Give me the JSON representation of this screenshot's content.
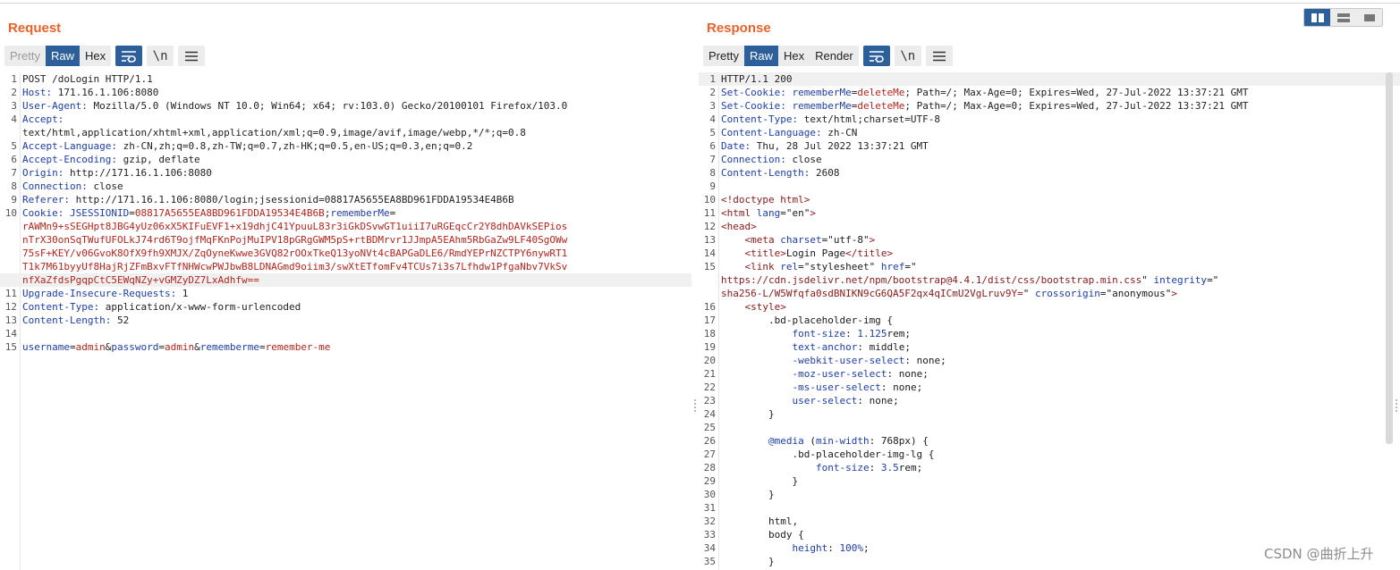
{
  "request": {
    "title": "Request",
    "tabs": [
      "Pretty",
      "Raw",
      "Hex"
    ],
    "active_tab": "Raw",
    "newline_label": "\\n",
    "lines": [
      {
        "n": "1",
        "k": "",
        "v": "POST /doLogin HTTP/1.1"
      },
      {
        "n": "2",
        "k": "Host:",
        "v": " 171.16.1.106:8080"
      },
      {
        "n": "3",
        "k": "User-Agent:",
        "v": " Mozilla/5.0 (Windows NT 10.0; Win64; x64; rv:103.0) Gecko/20100101 Firefox/103.0"
      },
      {
        "n": "4",
        "k": "Accept:",
        "v": ""
      },
      {
        "n": "",
        "k": "",
        "v": "text/html,application/xhtml+xml,application/xml;q=0.9,image/avif,image/webp,*/*;q=0.8"
      },
      {
        "n": "5",
        "k": "Accept-Language:",
        "v": " zh-CN,zh;q=0.8,zh-TW;q=0.7,zh-HK;q=0.5,en-US;q=0.3,en;q=0.2"
      },
      {
        "n": "6",
        "k": "Accept-Encoding:",
        "v": " gzip, deflate"
      },
      {
        "n": "7",
        "k": "Origin:",
        "v": " http://171.16.1.106:8080"
      },
      {
        "n": "8",
        "k": "Connection:",
        "v": " close"
      },
      {
        "n": "9",
        "k": "Referer:",
        "v": " http://171.16.1.106:8080/login;jsessionid=08817A5655EA8BD961FDDA19534E4B6B"
      }
    ],
    "cookie": {
      "n": "10",
      "k": "Cookie:",
      "jsession_key": "JSESSIONID",
      "jsession_val": "08817A5655EA8BD961FDDA19534E4B6B",
      "rm_key": "rememberMe",
      "continuation": [
        "rAWMn9+sSEGHpt8JBG4yUz06xX5KIFuEVF1+x19dhjC41YpuuL83r3iGkDSvwGT1uiiI7uRGEqcCr2Y8dhDAVkSEPios",
        "nTrX30onSqTWufUFOLkJ74rd6T9ojfMqFKnPojMuIPV18pGRgGWM5pS+rtBDMrvr1JJmpA5EAhm5RbGaZw9LF40SgOWw",
        "75sF+KEY/v06GvoK8OfX9fh9XMJX/ZqOyneKwwe3GVQ82rOOxTkeQ13yoNVt4cBAPGaDLE6/RmdYEPrNZCTPY6nywRT1",
        "T1k7M61byyUf8HajRjZFmBxvFTfNHWcwPWJbwB8LDNAGmd9oiim3/swXtETfomFv4TCUs7i3s7Lfhdw1PfgaNbv7VkSv",
        "nfXaZfdsPgqpCtC5EWqNZy+vGMZyDZ7LxAdhfw=="
      ]
    },
    "after_lines": [
      {
        "n": "11",
        "k": "Upgrade-Insecure-Requests:",
        "v": " 1"
      },
      {
        "n": "12",
        "k": "Content-Type:",
        "v": " application/x-www-form-urlencoded"
      },
      {
        "n": "13",
        "k": "Content-Length:",
        "v": " 52"
      },
      {
        "n": "14",
        "k": "",
        "v": ""
      }
    ],
    "body_line": {
      "n": "15",
      "params": [
        {
          "k": "username",
          "v": "admin"
        },
        {
          "k": "password",
          "v": "admin"
        },
        {
          "k": "rememberme",
          "v": "remember-me"
        }
      ]
    }
  },
  "response": {
    "title": "Response",
    "tabs": [
      "Pretty",
      "Raw",
      "Hex",
      "Render"
    ],
    "active_tab": "Raw",
    "newline_label": "\\n",
    "headers": [
      {
        "n": "1",
        "k": "",
        "v": "HTTP/1.1 200"
      },
      {
        "n": "2",
        "k": "Set-Cookie:",
        "v": " ",
        "ck": "rememberMe",
        "cv": "deleteMe",
        "rest": "; Path=/; Max-Age=0; Expires=Wed, 27-Jul-2022 13:37:21 GMT"
      },
      {
        "n": "3",
        "k": "Set-Cookie:",
        "v": " ",
        "ck": "rememberMe",
        "cv": "deleteMe",
        "rest": "; Path=/; Max-Age=0; Expires=Wed, 27-Jul-2022 13:37:21 GMT"
      },
      {
        "n": "4",
        "k": "Content-Type:",
        "v": " text/html;charset=UTF-8"
      },
      {
        "n": "5",
        "k": "Content-Language:",
        "v": " zh-CN"
      },
      {
        "n": "6",
        "k": "Date:",
        "v": " Thu, 28 Jul 2022 13:37:21 GMT"
      },
      {
        "n": "7",
        "k": "Connection:",
        "v": " close"
      },
      {
        "n": "8",
        "k": "Content-Length:",
        "v": " 2608"
      },
      {
        "n": "9",
        "k": "",
        "v": ""
      }
    ],
    "html_lines": [
      {
        "n": "10",
        "parts": [
          [
            "tag",
            "<!doctype html>"
          ]
        ]
      },
      {
        "n": "11",
        "parts": [
          [
            "tag",
            "<html "
          ],
          [
            "attr",
            "lang"
          ],
          [
            "str",
            "=\"en\""
          ],
          [
            "tag",
            ">"
          ]
        ]
      },
      {
        "n": "12",
        "parts": [
          [
            "tag",
            "<head>"
          ]
        ]
      },
      {
        "n": "13",
        "parts": [
          [
            "str",
            "    "
          ],
          [
            "tag",
            "<meta "
          ],
          [
            "attr",
            "charset"
          ],
          [
            "str",
            "=\"utf-8\""
          ],
          [
            "tag",
            ">"
          ]
        ]
      },
      {
        "n": "14",
        "parts": [
          [
            "str",
            "    "
          ],
          [
            "tag",
            "<title>"
          ],
          [
            "str",
            "Login Page"
          ],
          [
            "tag",
            "</title>"
          ]
        ]
      },
      {
        "n": "15",
        "parts": [
          [
            "str",
            "    "
          ],
          [
            "tag",
            "<link "
          ],
          [
            "attr",
            "rel"
          ],
          [
            "str",
            "=\"stylesheet\" "
          ],
          [
            "attr",
            "href"
          ],
          [
            "str",
            "=\""
          ]
        ]
      },
      {
        "n": "",
        "parts": [
          [
            "tag",
            "https://cdn.jsdelivr.net/npm/bootstrap@4.4.1/dist/css/bootstrap.min.css"
          ],
          [
            "str",
            "\" "
          ],
          [
            "attr",
            "integrity"
          ],
          [
            "str",
            "=\""
          ]
        ]
      },
      {
        "n": "",
        "parts": [
          [
            "tag",
            "sha256-L/W5Wfqfa0sdBNIKN9cG6QA5F2qx4qICmU2VgLruv9Y="
          ],
          [
            "str",
            "\" "
          ],
          [
            "attr",
            "crossorigin"
          ],
          [
            "str",
            "=\"anonymous\""
          ],
          [
            "tag",
            ">"
          ]
        ]
      },
      {
        "n": "16",
        "parts": [
          [
            "str",
            "    "
          ],
          [
            "tag",
            "<style>"
          ]
        ]
      },
      {
        "n": "17",
        "parts": [
          [
            "str",
            "        .bd-placeholder-img {"
          ]
        ]
      },
      {
        "n": "18",
        "parts": [
          [
            "str",
            "            "
          ],
          [
            "attr",
            "font-size"
          ],
          [
            "str",
            ": "
          ],
          [
            "attr",
            "1.125"
          ],
          [
            "str",
            "rem;"
          ]
        ]
      },
      {
        "n": "19",
        "parts": [
          [
            "str",
            "            "
          ],
          [
            "attr",
            "text-anchor"
          ],
          [
            "str",
            ": middle;"
          ]
        ]
      },
      {
        "n": "20",
        "parts": [
          [
            "str",
            "            "
          ],
          [
            "attr",
            "-webkit-user-select"
          ],
          [
            "str",
            ": none;"
          ]
        ]
      },
      {
        "n": "21",
        "parts": [
          [
            "str",
            "            "
          ],
          [
            "attr",
            "-moz-user-select"
          ],
          [
            "str",
            ": none;"
          ]
        ]
      },
      {
        "n": "22",
        "parts": [
          [
            "str",
            "            "
          ],
          [
            "attr",
            "-ms-user-select"
          ],
          [
            "str",
            ": none;"
          ]
        ]
      },
      {
        "n": "23",
        "parts": [
          [
            "str",
            "            "
          ],
          [
            "attr",
            "user-select"
          ],
          [
            "str",
            ": none;"
          ]
        ]
      },
      {
        "n": "24",
        "parts": [
          [
            "str",
            "        }"
          ]
        ]
      },
      {
        "n": "25",
        "parts": [
          [
            "str",
            ""
          ]
        ]
      },
      {
        "n": "26",
        "parts": [
          [
            "str",
            "        "
          ],
          [
            "attr",
            "@media"
          ],
          [
            "str",
            " ("
          ],
          [
            "attr",
            "min-width"
          ],
          [
            "str",
            ": 768px) {"
          ]
        ]
      },
      {
        "n": "27",
        "parts": [
          [
            "str",
            "            .bd-placeholder-img-lg {"
          ]
        ]
      },
      {
        "n": "28",
        "parts": [
          [
            "str",
            "                "
          ],
          [
            "attr",
            "font-size"
          ],
          [
            "str",
            ": "
          ],
          [
            "attr",
            "3.5"
          ],
          [
            "str",
            "rem;"
          ]
        ]
      },
      {
        "n": "29",
        "parts": [
          [
            "str",
            "            }"
          ]
        ]
      },
      {
        "n": "30",
        "parts": [
          [
            "str",
            "        }"
          ]
        ]
      },
      {
        "n": "31",
        "parts": [
          [
            "str",
            ""
          ]
        ]
      },
      {
        "n": "32",
        "parts": [
          [
            "str",
            "        html,"
          ]
        ]
      },
      {
        "n": "33",
        "parts": [
          [
            "str",
            "        body {"
          ]
        ]
      },
      {
        "n": "34",
        "parts": [
          [
            "str",
            "            "
          ],
          [
            "attr",
            "height"
          ],
          [
            "str",
            ": "
          ],
          [
            "attr",
            "100%"
          ],
          [
            "str",
            ";"
          ]
        ]
      },
      {
        "n": "35",
        "parts": [
          [
            "str",
            "        }"
          ]
        ]
      }
    ]
  },
  "watermark": "CSDN @曲折上升",
  "colors": {
    "title": "#e8622c",
    "active": "#2d5f9a",
    "key": "#1e3ea8",
    "cookie": "#b3261e"
  }
}
